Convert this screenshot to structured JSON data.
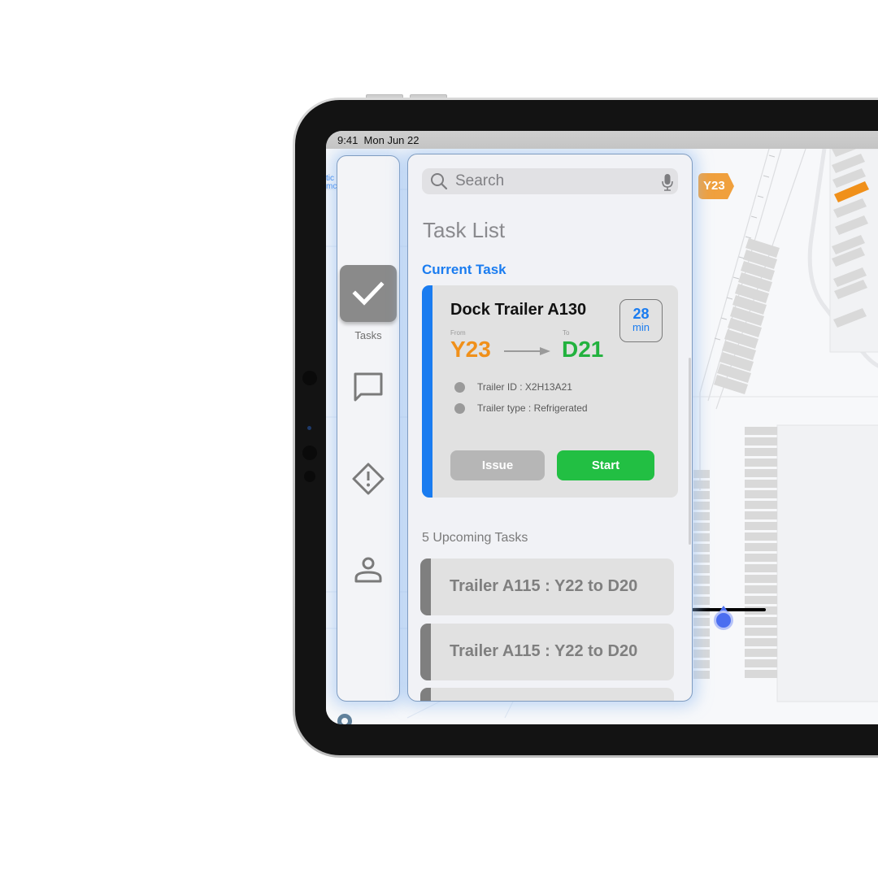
{
  "status_bar": {
    "time": "9:41",
    "date": "Mon Jun 22"
  },
  "nav": {
    "items": [
      {
        "id": "tasks",
        "label": "Tasks",
        "icon": "checkmark-icon",
        "active": true
      },
      {
        "id": "messages",
        "label": "",
        "icon": "chat-bubble-icon",
        "active": false
      },
      {
        "id": "alerts",
        "label": "",
        "icon": "warning-diamond-icon",
        "active": false
      },
      {
        "id": "profile",
        "label": "",
        "icon": "person-icon",
        "active": false
      }
    ]
  },
  "task_panel": {
    "search": {
      "placeholder": "Search",
      "value": ""
    },
    "title": "Task List",
    "current_section_label": "Current Task",
    "current_task": {
      "title": "Dock Trailer A130",
      "eta_value": "28",
      "eta_unit": "min",
      "from_label": "From",
      "from": "Y23",
      "to_label": "To",
      "to": "D21",
      "details": [
        "Trailer ID : X2H13A21",
        "Trailer type : Refrigerated"
      ],
      "issue_label": "Issue",
      "start_label": "Start"
    },
    "upcoming_section_label": "5 Upcoming Tasks",
    "upcoming_count": 5,
    "upcoming_tasks": [
      "Trailer A115 : Y22 to D20",
      "Trailer A115 : Y22 to D20",
      ""
    ]
  },
  "map": {
    "yard_label": "Y23",
    "colors": {
      "yard_label": "#f0a03d",
      "highlight_slot": "#f0901a",
      "location": "#4b6ef0"
    }
  },
  "colors": {
    "accent_blue": "#1a7cf0",
    "from_orange": "#f0901a",
    "to_green": "#22b23e",
    "start_green": "#22bf43",
    "issue_gray": "#b6b6b6"
  }
}
